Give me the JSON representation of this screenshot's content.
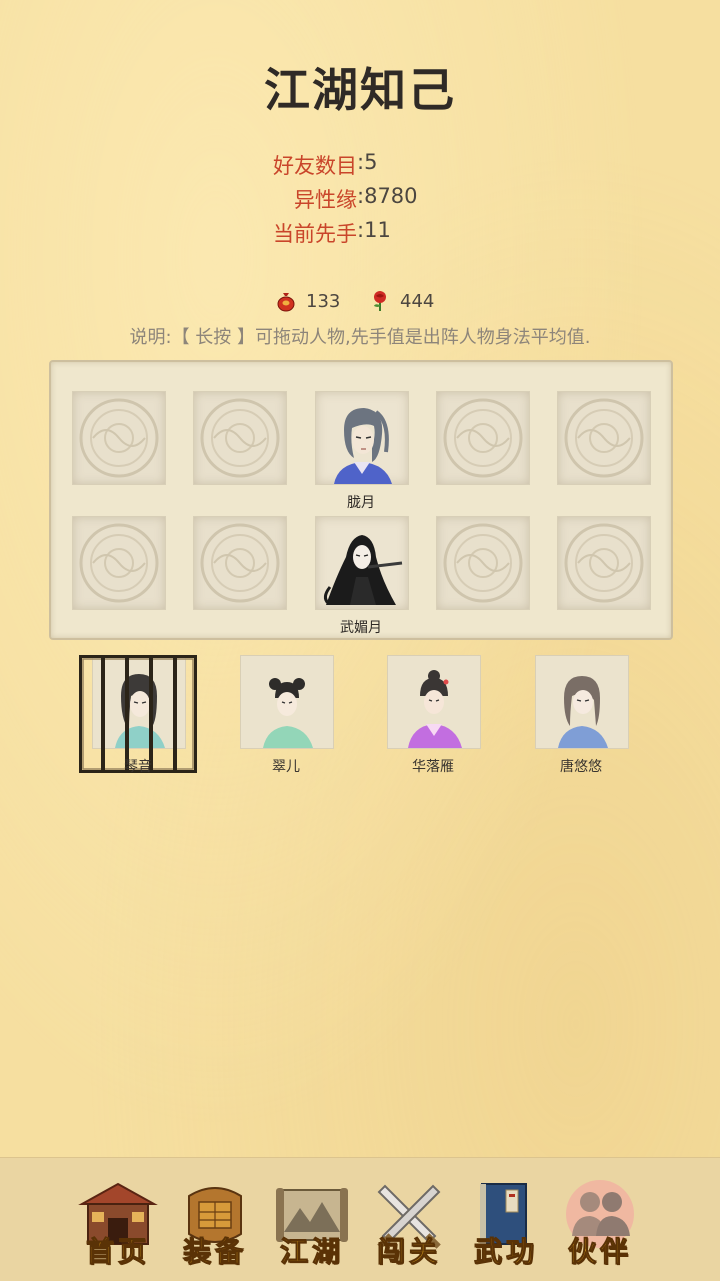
{
  "page": {
    "title": "江湖知己"
  },
  "stats": [
    {
      "label": "好友数目",
      "value": "5"
    },
    {
      "label": "异性缘",
      "value": "8780"
    },
    {
      "label": "当前先手",
      "value": "11"
    }
  ],
  "currency": [
    {
      "icon": "red-pouch-icon",
      "value": "133"
    },
    {
      "icon": "rose-icon",
      "value": "444"
    }
  ],
  "hint": "说明:【 长按 】可拖动人物,先手值是出阵人物身法平均值.",
  "formation": {
    "row1_name": "胧月",
    "row2_name": "武媚月"
  },
  "reserve": [
    {
      "name": "琴音",
      "locked": true
    },
    {
      "name": "翠儿",
      "locked": false
    },
    {
      "name": "华落雁",
      "locked": false
    },
    {
      "name": "唐悠悠",
      "locked": false
    }
  ],
  "nav": [
    {
      "label": "首页",
      "icon": "house-icon"
    },
    {
      "label": "装备",
      "icon": "armor-icon"
    },
    {
      "label": "江湖",
      "icon": "map-scroll-icon"
    },
    {
      "label": "闯关",
      "icon": "crossed-swords-icon"
    },
    {
      "label": "武功",
      "icon": "book-icon"
    },
    {
      "label": "伙伴",
      "icon": "partners-icon",
      "active": true
    }
  ],
  "colors": {
    "accent_red": "#c9452a",
    "nav_gold": "#e0a31c",
    "background": "#f6dfa0"
  }
}
